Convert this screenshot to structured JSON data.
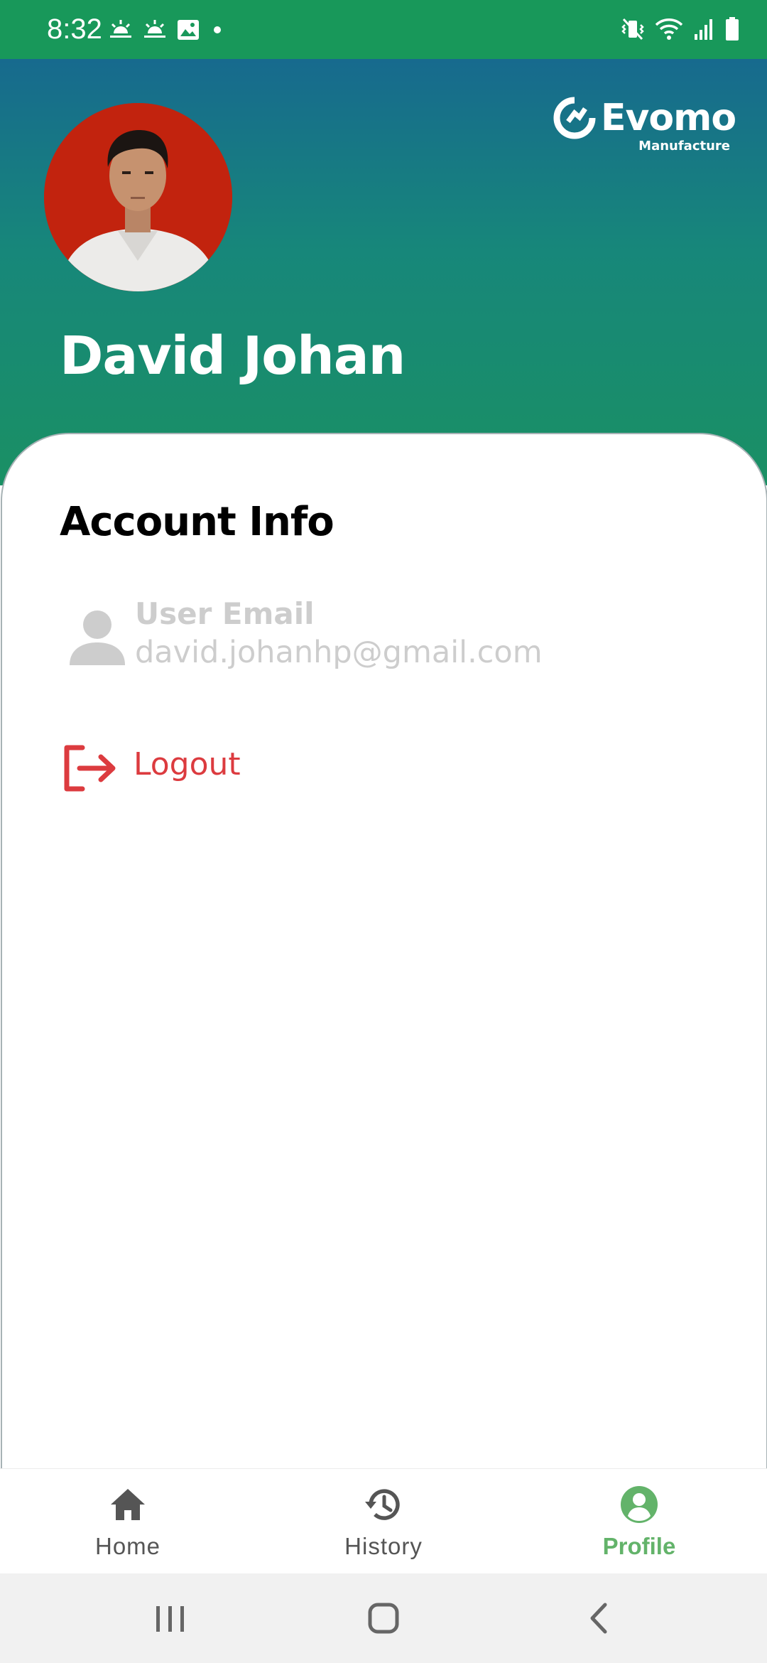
{
  "status_bar": {
    "time": "8:32",
    "icons_left": [
      "weather-sunrise-icon",
      "weather-sunrise-icon",
      "image-icon",
      "notification-dot"
    ],
    "icons_right": [
      "vibrate-mute-icon",
      "wifi-icon",
      "signal-icon",
      "battery-icon"
    ],
    "background": "#18985a"
  },
  "header": {
    "brand_name": "Evomo",
    "brand_sub": "Manufacture",
    "user_name": "David Johan",
    "gradient": [
      "#176a8e",
      "#1a9064"
    ]
  },
  "account": {
    "title": "Account Info",
    "email_label": "User Email",
    "email_value": "david.johanhp@gmail.com",
    "logout_label": "Logout",
    "logout_color": "#dc3b3f"
  },
  "bottom_nav": {
    "items": [
      {
        "label": "Home",
        "icon": "home-icon",
        "active": false
      },
      {
        "label": "History",
        "icon": "history-icon",
        "active": false
      },
      {
        "label": "Profile",
        "icon": "profile-icon",
        "active": true
      }
    ],
    "active_color": "#63b36a"
  },
  "system_nav": {
    "buttons": [
      "recent-apps-icon",
      "home-circle-icon",
      "back-icon"
    ]
  }
}
